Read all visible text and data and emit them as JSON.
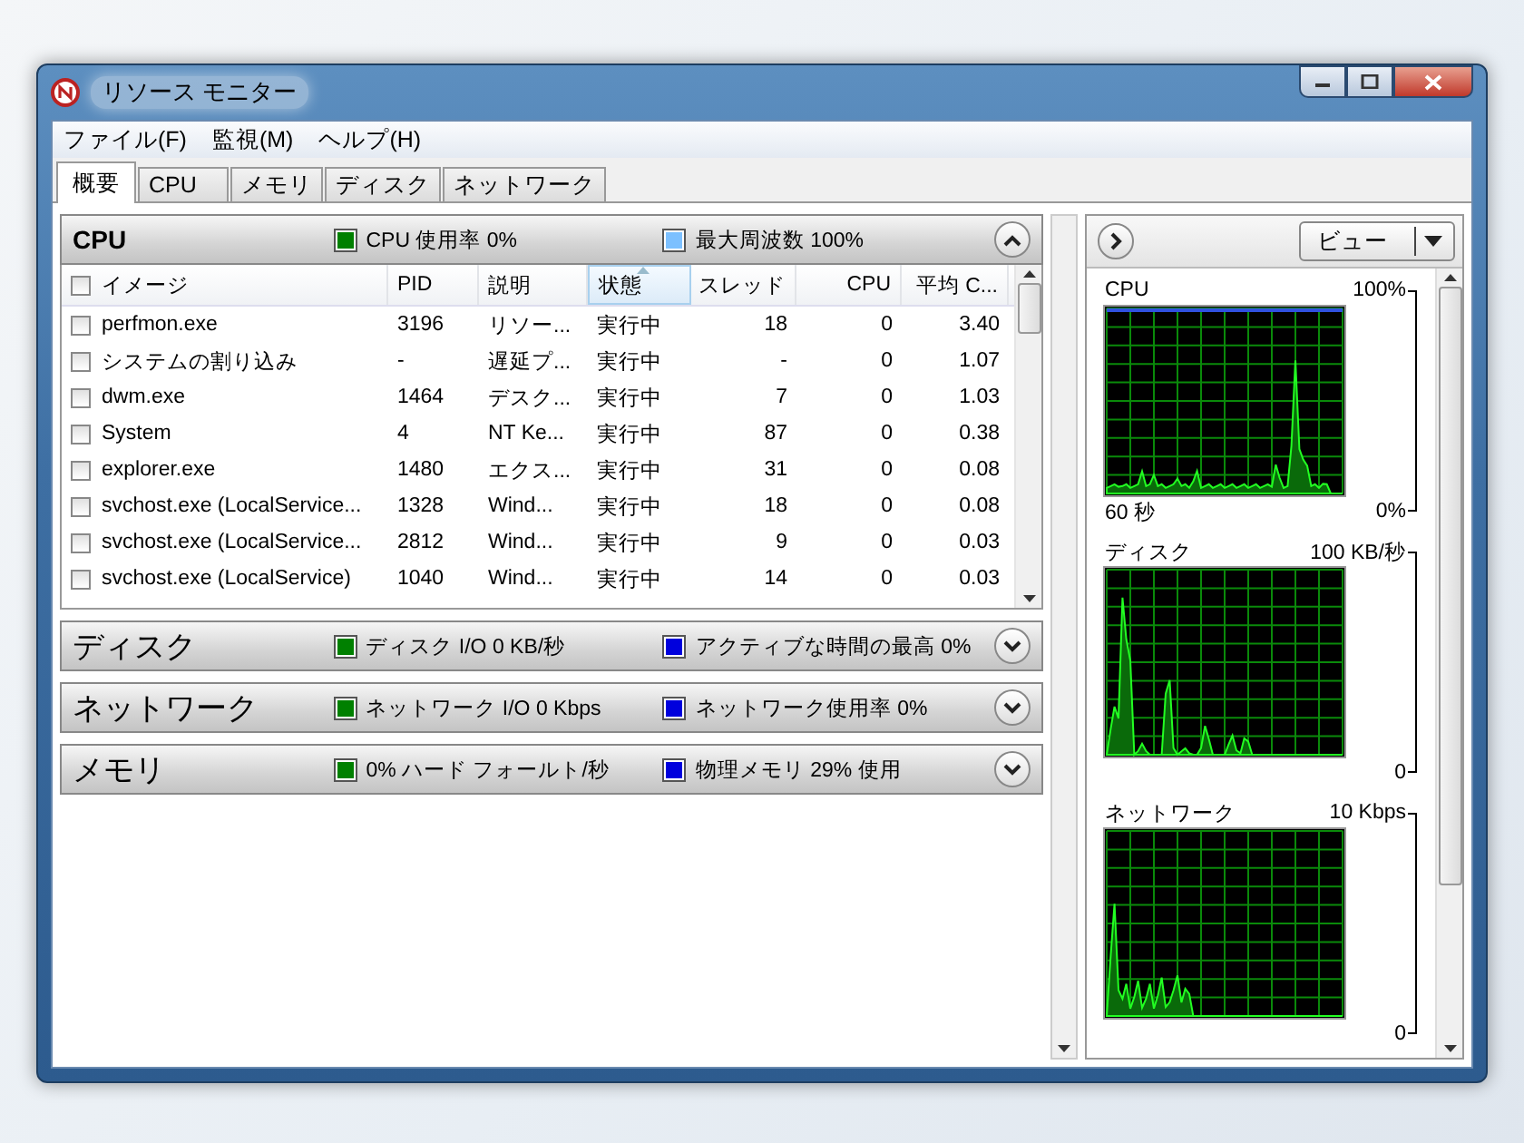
{
  "window": {
    "title": "リソース モニター"
  },
  "menu": [
    "ファイル(F)",
    "監視(M)",
    "ヘルプ(H)"
  ],
  "tabs": [
    {
      "label": "概要",
      "selected": true
    },
    {
      "label": "CPU",
      "selected": false
    },
    {
      "label": "メモリ",
      "selected": false
    },
    {
      "label": "ディスク",
      "selected": false
    },
    {
      "label": "ネットワーク",
      "selected": false
    }
  ],
  "sections": [
    {
      "title": "CPU",
      "expanded": true,
      "legend": [
        {
          "label": "CPU 使用率 0%",
          "color": "#008000"
        },
        {
          "label": "最大周波数 100%",
          "color": "#7cc0ff"
        }
      ],
      "table": {
        "header_checked": false,
        "columns": [
          {
            "label": "イメージ",
            "kind": "text",
            "sorted": false
          },
          {
            "label": "PID",
            "kind": "text",
            "sorted": false
          },
          {
            "label": "説明",
            "kind": "text",
            "sorted": false
          },
          {
            "label": "状態",
            "kind": "text",
            "sorted": true
          },
          {
            "label": "スレッド",
            "kind": "number",
            "sorted": false
          },
          {
            "label": "CPU",
            "kind": "number",
            "sorted": false
          },
          {
            "label": "平均 C...",
            "kind": "number",
            "sorted": false
          }
        ],
        "rows": [
          {
            "checked": false,
            "cells": [
              "perfmon.exe",
              "3196",
              "リソー...",
              "実行中",
              "18",
              "0",
              "3.40"
            ]
          },
          {
            "checked": false,
            "cells": [
              "システムの割り込み",
              "-",
              "遅延プ...",
              "実行中",
              "-",
              "0",
              "1.07"
            ]
          },
          {
            "checked": false,
            "cells": [
              "dwm.exe",
              "1464",
              "デスク...",
              "実行中",
              "7",
              "0",
              "1.03"
            ]
          },
          {
            "checked": false,
            "cells": [
              "System",
              "4",
              "NT Ke...",
              "実行中",
              "87",
              "0",
              "0.38"
            ]
          },
          {
            "checked": false,
            "cells": [
              "explorer.exe",
              "1480",
              "エクス...",
              "実行中",
              "31",
              "0",
              "0.08"
            ]
          },
          {
            "checked": false,
            "cells": [
              "svchost.exe (LocalService...",
              "1328",
              "Wind...",
              "実行中",
              "18",
              "0",
              "0.08"
            ]
          },
          {
            "checked": false,
            "cells": [
              "svchost.exe (LocalService...",
              "2812",
              "Wind...",
              "実行中",
              "9",
              "0",
              "0.03"
            ]
          },
          {
            "checked": false,
            "cells": [
              "svchost.exe (LocalService)",
              "1040",
              "Wind...",
              "実行中",
              "14",
              "0",
              "0.03"
            ]
          }
        ]
      }
    },
    {
      "title": "ディスク",
      "expanded": false,
      "legend": [
        {
          "label": "ディスク I/O 0 KB/秒",
          "color": "#008000"
        },
        {
          "label": "アクティブな時間の最高 0%",
          "color": "#0000dd"
        }
      ]
    },
    {
      "title": "ネットワーク",
      "expanded": false,
      "legend": [
        {
          "label": "ネットワーク I/O 0 Kbps",
          "color": "#008000"
        },
        {
          "label": "ネットワーク使用率 0%",
          "color": "#0000dd"
        }
      ]
    },
    {
      "title": "メモリ",
      "expanded": false,
      "legend": [
        {
          "label": "0% ハード フォールト/秒",
          "color": "#008000"
        },
        {
          "label": "物理メモリ 29% 使用",
          "color": "#0000dd"
        }
      ]
    }
  ],
  "view_button": "ビュー",
  "graphs": [
    {
      "title": "CPU",
      "max": "100%",
      "time": "60 秒",
      "min": "0%"
    },
    {
      "title": "ディスク",
      "max": "100 KB/秒",
      "min": "0"
    },
    {
      "title": "ネットワーク",
      "max": "10 Kbps",
      "min": "0"
    }
  ]
}
